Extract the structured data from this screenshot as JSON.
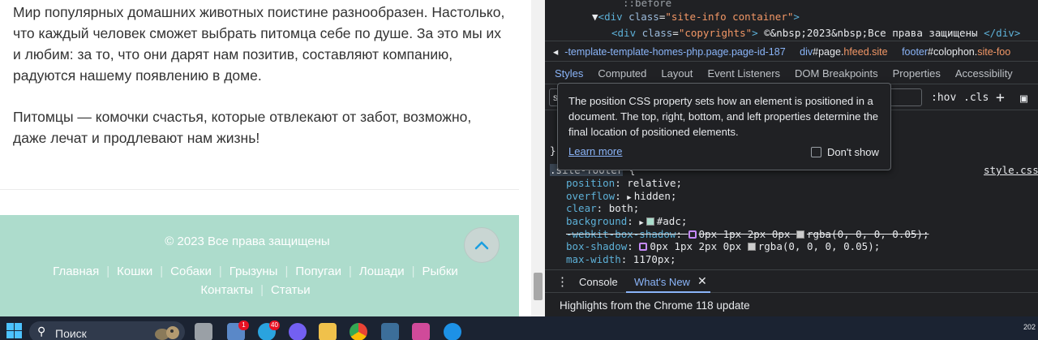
{
  "site": {
    "paragraph1": "Мир популярных домашних животных поистине разнообразен. Настолько, что каждый человек сможет выбрать питомца себе по душе. За это мы их и любим: за то, что они дарят нам позитив, составляют компанию, радуются нашему появлению в доме.",
    "paragraph2": "Питомцы — комочки счастья, которые отвлекают от забот, возможно, даже лечат и продлевают нам жизнь!",
    "footer": {
      "copyright": "© 2023 Все права защищены",
      "nav": [
        "Главная",
        "Кошки",
        "Собаки",
        "Грызуны",
        "Попугаи",
        "Лошади",
        "Рыбки",
        "Контакты",
        "Статьи"
      ],
      "background": "#addccc"
    }
  },
  "devtools": {
    "elements": {
      "line1_pseudo": "::before",
      "line2_tag": "div",
      "line2_attr": "class",
      "line2_val": "\"site-info container\"",
      "line3_tag": "div",
      "line3_attr": "class",
      "line3_val": "\"copyrights\"",
      "line3_text": "©&nbsp;2023&nbsp;Все права защищены",
      "line3_close": "</div>"
    },
    "breadcrumbs": {
      "c1": "-template-template-homes-php.page.page-id-187",
      "c2_tag": "div",
      "c2_rest": "#page.",
      "c2_class": "hfeed.site",
      "c3_tag": "footer",
      "c3_rest": "#colophon.",
      "c3_class": "site-foo"
    },
    "panel_tabs": [
      "Styles",
      "Computed",
      "Layout",
      "Event Listeners",
      "DOM Breakpoints",
      "Properties",
      "Accessibility"
    ],
    "filter_value": "s",
    "hov": ":hov",
    "cls": ".cls",
    "selector": ".site-footer",
    "stylesheet": "style.css",
    "declarations": [
      {
        "prop": "position",
        "value": "relative;"
      },
      {
        "prop": "overflow",
        "value": "hidden;"
      },
      {
        "prop": "clear",
        "value": "both;"
      },
      {
        "prop": "background",
        "value": "#adc;"
      },
      {
        "prop": "-webkit-box-shadow",
        "value": "0px 1px 2px 0px",
        "value2": "rgba(0, 0, 0, 0.05);"
      },
      {
        "prop": "box-shadow",
        "value": "0px 1px 2px 0px",
        "value2": "rgba(0, 0, 0, 0.05);"
      },
      {
        "prop": "max-width",
        "value": "1170px;"
      }
    ],
    "tooltip": {
      "text": "The position CSS property sets how an element is positioned in a document. The top, right, bottom, and left properties determine the final location of positioned elements.",
      "learn_more": "Learn more",
      "dont_show": "Don't show"
    },
    "drawer": {
      "console": "Console",
      "whats_new": "What's New",
      "highlights": "Highlights from the Chrome 118 update"
    }
  },
  "taskbar": {
    "search_label": "Поиск",
    "telegram_badge": "40",
    "notification_badge": "1",
    "time": "202"
  }
}
